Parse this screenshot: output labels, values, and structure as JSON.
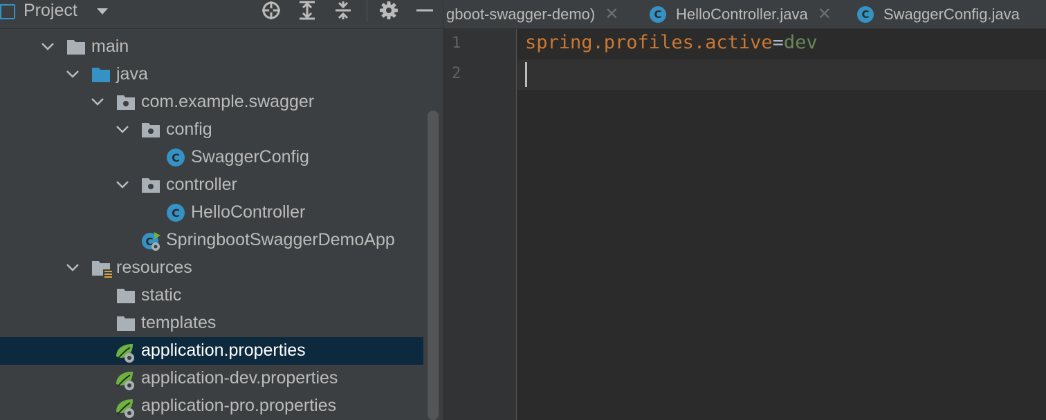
{
  "project_panel": {
    "title": "Project",
    "toolbar": [
      "crosshair-locate-icon",
      "expand-all-icon",
      "collapse-all-icon",
      "gear-icon",
      "hide-minus-icon"
    ]
  },
  "tree": {
    "items": [
      {
        "label": "main",
        "icon": "folder-gray",
        "expanded": true
      },
      {
        "label": "java",
        "icon": "folder-source-blue",
        "expanded": true
      },
      {
        "label": "com.example.swagger",
        "icon": "package-folder",
        "expanded": true
      },
      {
        "label": "config",
        "icon": "package-folder",
        "expanded": true
      },
      {
        "label": "SwaggerConfig",
        "icon": "java-class-c"
      },
      {
        "label": "controller",
        "icon": "package-folder",
        "expanded": true
      },
      {
        "label": "HelloController",
        "icon": "java-class-c"
      },
      {
        "label": "SpringbootSwaggerDemoApp",
        "icon": "spring-boot-app"
      },
      {
        "label": "resources",
        "icon": "resources-folder",
        "expanded": true
      },
      {
        "label": "static",
        "icon": "folder-gray"
      },
      {
        "label": "templates",
        "icon": "folder-gray"
      },
      {
        "label": "application.properties",
        "icon": "spring-properties",
        "selected": true
      },
      {
        "label": "application-dev.properties",
        "icon": "spring-properties"
      },
      {
        "label": "application-pro.properties",
        "icon": "spring-properties"
      }
    ]
  },
  "editor": {
    "tabs": [
      {
        "label": "gboot-swagger-demo)",
        "icon": ""
      },
      {
        "label": "HelloController.java",
        "icon": "java-class-c"
      },
      {
        "label": "SwaggerConfig.java",
        "icon": "java-class-c"
      }
    ],
    "line_numbers": [
      "1",
      "2"
    ],
    "code": {
      "key": "spring.profiles.active",
      "eq": "=",
      "value": "dev"
    }
  },
  "colors": {
    "panel_bg": "#3c3f41",
    "editor_bg": "#2b2b2b",
    "selection_bg": "#0d293e",
    "accent_blue": "#3592c4",
    "keyword_orange": "#cc7832",
    "value_green": "#6a8759",
    "spring_green": "#6db33f"
  }
}
